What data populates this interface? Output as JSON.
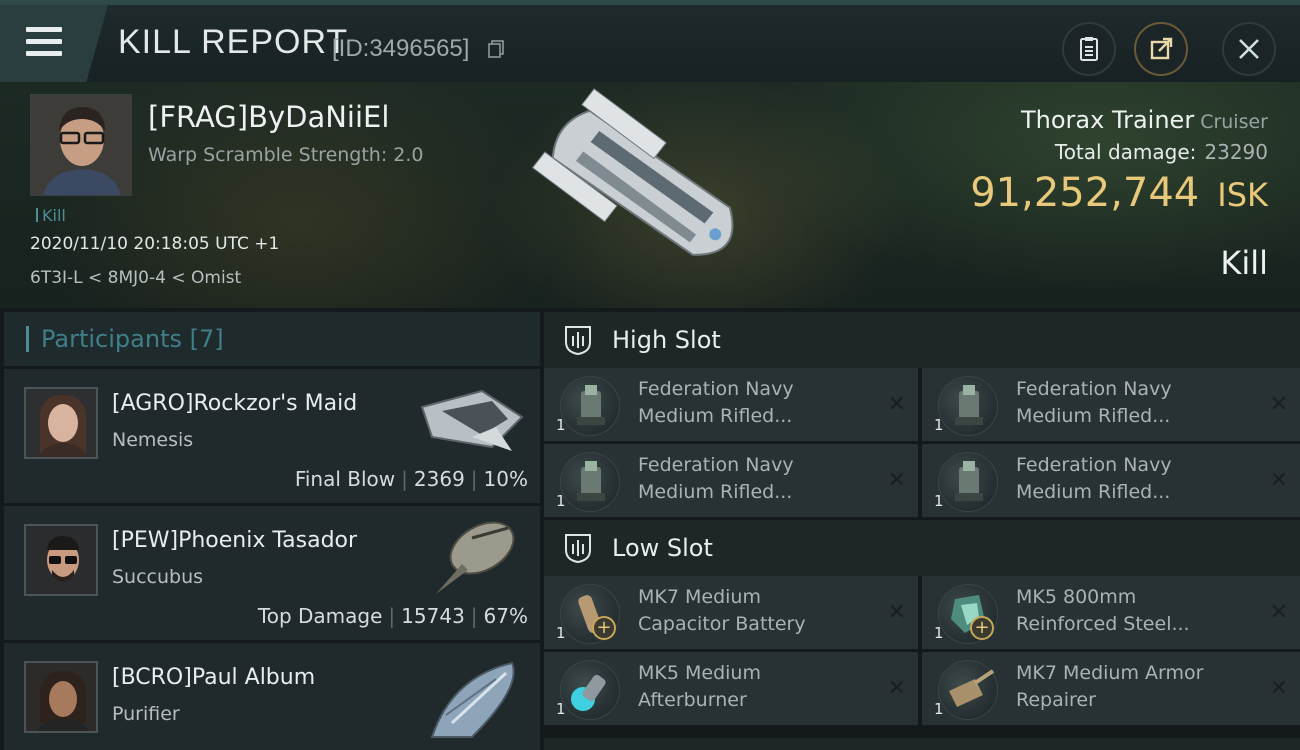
{
  "header": {
    "title": "KILL REPORT",
    "report_id": "[ID:3496565]"
  },
  "victim": {
    "pilot": "[FRAG]ByDaNiiEl",
    "warp_scramble": "Warp Scramble Strength: 2.0",
    "tag": "Kill",
    "timestamp": "2020/11/10 20:18:05 UTC +1",
    "location": "6T3I-L < 8MJ0-4 < Omist",
    "ship_name": "Thorax Trainer",
    "ship_class": "Cruiser",
    "total_damage_label": "Total damage:",
    "total_damage": "23290",
    "isk_value": "91,252,744",
    "isk_unit": "ISK",
    "result": "Kill"
  },
  "participants": {
    "header": "Participants [7]",
    "rows": [
      {
        "name": "[AGRO]Rockzor's Maid",
        "ship": "Nemesis",
        "role": "Final Blow",
        "damage": "2369",
        "percent": "10%"
      },
      {
        "name": "[PEW]Phoenix Tasador",
        "ship": "Succubus",
        "role": "Top Damage",
        "damage": "15743",
        "percent": "67%"
      },
      {
        "name": "[BCRO]Paul Album",
        "ship": "Purifier"
      }
    ]
  },
  "slots": {
    "high": {
      "label": "High Slot",
      "items": [
        {
          "qty": "1",
          "line1": "Federation Navy",
          "line2": "Medium Rifled..."
        },
        {
          "qty": "1",
          "line1": "Federation Navy",
          "line2": "Medium Rifled..."
        },
        {
          "qty": "1",
          "line1": "Federation Navy",
          "line2": "Medium Rifled..."
        },
        {
          "qty": "1",
          "line1": "Federation Navy",
          "line2": "Medium Rifled..."
        }
      ]
    },
    "low": {
      "label": "Low Slot",
      "items": [
        {
          "qty": "1",
          "line1": "MK7 Medium",
          "line2": "Capacitor Battery"
        },
        {
          "qty": "1",
          "line1": "MK5 800mm",
          "line2": "Reinforced Steel..."
        },
        {
          "qty": "1",
          "line1": "MK5 Medium",
          "line2": "Afterburner"
        },
        {
          "qty": "1",
          "line1": "MK7 Medium Armor",
          "line2": "Repairer"
        }
      ]
    }
  },
  "icons": {
    "menu": "hamburger-menu-icon",
    "copy": "copy-icon",
    "clipboard": "clipboard-icon",
    "share": "share-icon",
    "close": "close-icon",
    "slot": "slot-shield-icon",
    "item_close": "x-icon"
  },
  "colors": {
    "accent_teal": "#4a8f97",
    "isk_gold": "#e8c87a",
    "background": "#14191c"
  }
}
